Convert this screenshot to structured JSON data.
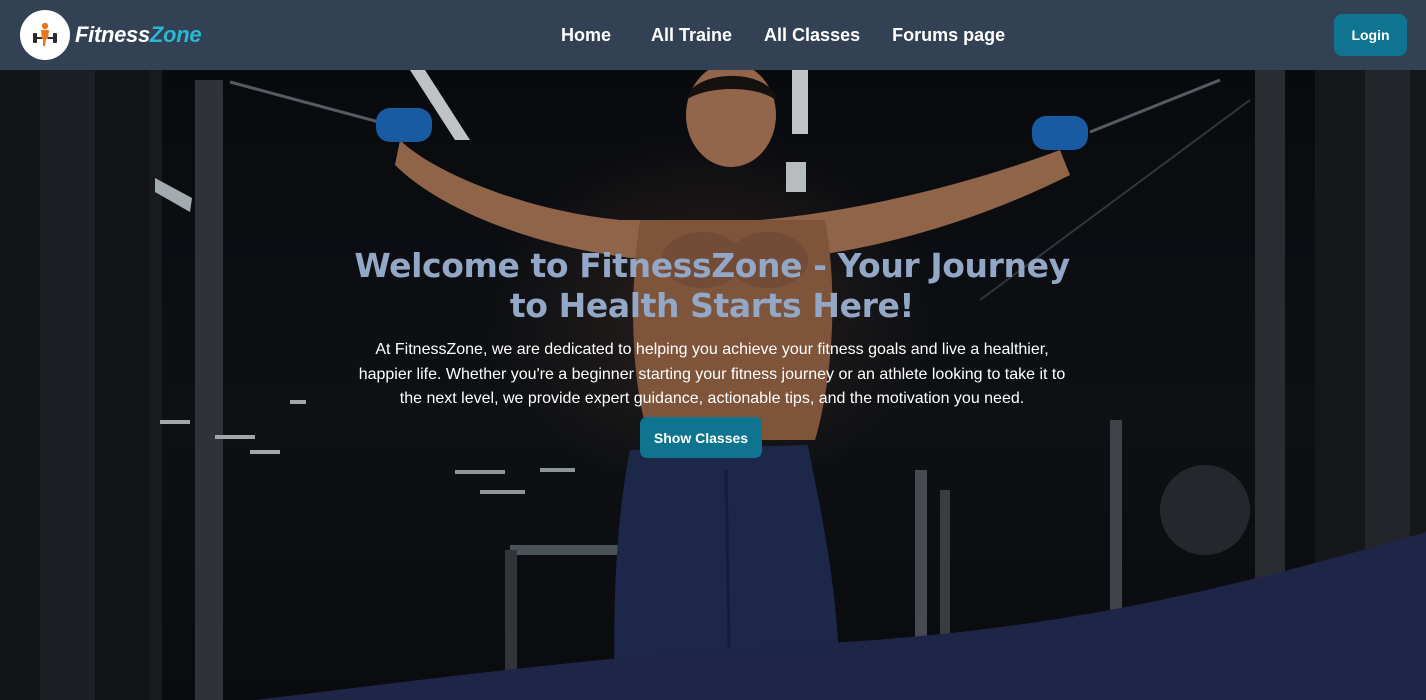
{
  "brand": {
    "name_part1": "Fitness",
    "name_part2": "Zone",
    "logo_icon": "dumbbell-athlete-icon",
    "accent_color": "#2bb7d4"
  },
  "nav": {
    "links": [
      {
        "label": "Home"
      },
      {
        "label": "All Traine"
      },
      {
        "label": "All Classes"
      },
      {
        "label": "Forums page"
      }
    ],
    "login_label": "Login",
    "background_color": "#324154"
  },
  "hero": {
    "title": "Welcome to FitnessZone - Your Journey to Health Starts Here!",
    "description": "At FitnessZone, we are dedicated to helping you achieve your fitness goals and live a healthier, happier life. Whether you're a beginner starting your fitness journey or an athlete looking to take it to the next level, we provide expert guidance, actionable tips, and the motivation you need.",
    "cta_label": "Show Classes",
    "title_color": "#93a7c6",
    "button_color": "#0e7490",
    "wave_color": "#1e2547"
  }
}
